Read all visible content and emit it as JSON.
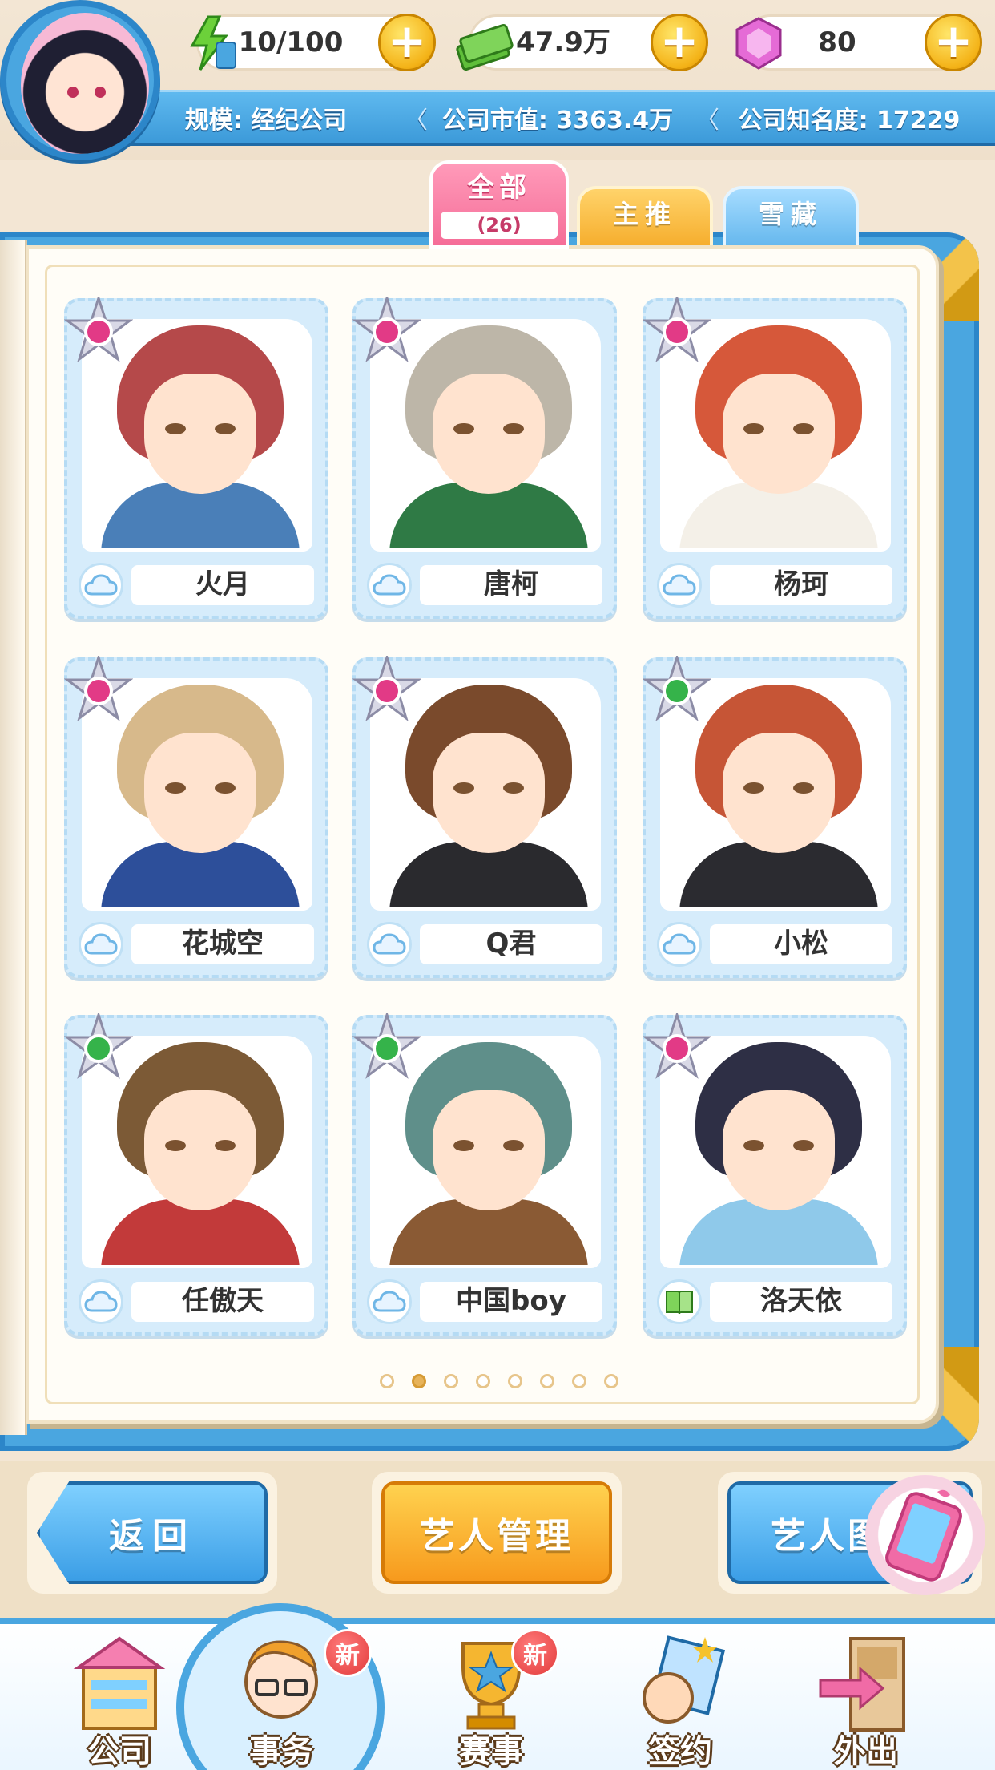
{
  "resources": {
    "energy": {
      "icon": "lightning-hourglass-icon",
      "value": "10/100"
    },
    "money": {
      "icon": "cash-stack-icon",
      "value": "47.9万"
    },
    "gems": {
      "icon": "pink-gem-icon",
      "value": "80"
    }
  },
  "company": {
    "scale": "规模: 经纪公司",
    "market_value": "公司市值: 3363.4万",
    "fame": "公司知名度: 17229"
  },
  "tabs": [
    {
      "label": "全部",
      "count": "(26)",
      "active": true
    },
    {
      "label": "主推",
      "active": false
    },
    {
      "label": "雪藏",
      "active": false
    }
  ],
  "artists": [
    {
      "name": "火月",
      "gem": "pink",
      "attr": "cloud",
      "hair": "#b5494a",
      "outfit": "#4a7fb8"
    },
    {
      "name": "唐柯",
      "gem": "pink",
      "attr": "cloud",
      "hair": "#bdb6a8",
      "outfit": "#2f7a45"
    },
    {
      "name": "杨珂",
      "gem": "pink",
      "attr": "cloud",
      "hair": "#d6583a",
      "outfit": "#f4f0e8"
    },
    {
      "name": "花城空",
      "gem": "pink",
      "attr": "cloud",
      "hair": "#d7b98b",
      "outfit": "#2d4f9a"
    },
    {
      "name": "Q君",
      "gem": "pink",
      "attr": "cloud",
      "hair": "#7a4a2c",
      "outfit": "#2a2a2e"
    },
    {
      "name": "小松",
      "gem": "green",
      "attr": "cloud",
      "hair": "#c65536",
      "outfit": "#2b2b30"
    },
    {
      "name": "任傲天",
      "gem": "green",
      "attr": "cloud",
      "hair": "#7c5a36",
      "outfit": "#c23a3a"
    },
    {
      "name": "中国boy",
      "gem": "green",
      "attr": "cloud",
      "hair": "#5f8f8a",
      "outfit": "#8a5a34"
    },
    {
      "name": "洛天依",
      "gem": "pink",
      "attr": "book",
      "hair": "#2e2f45",
      "outfit": "#8fc9ea"
    }
  ],
  "pagination": {
    "total": 8,
    "current": 2
  },
  "actions": {
    "back": "返回",
    "manage": "艺人管理",
    "gallery": "艺人图"
  },
  "nav": [
    {
      "label": "公司",
      "icon": "company-building-icon",
      "badge": ""
    },
    {
      "label": "事务",
      "icon": "manager-glasses-icon",
      "badge": "新",
      "active": true
    },
    {
      "label": "赛事",
      "icon": "trophy-star-icon",
      "badge": "新"
    },
    {
      "label": "签约",
      "icon": "contract-fist-icon",
      "badge": ""
    },
    {
      "label": "外出",
      "icon": "door-arrow-icon",
      "badge": ""
    }
  ],
  "colors": {
    "primary_blue": "#4aa6e0",
    "accent_pink": "#f56d98",
    "accent_gold": "#f6ae2e",
    "gem_pink": "#e23a86",
    "gem_green": "#35b34a"
  }
}
